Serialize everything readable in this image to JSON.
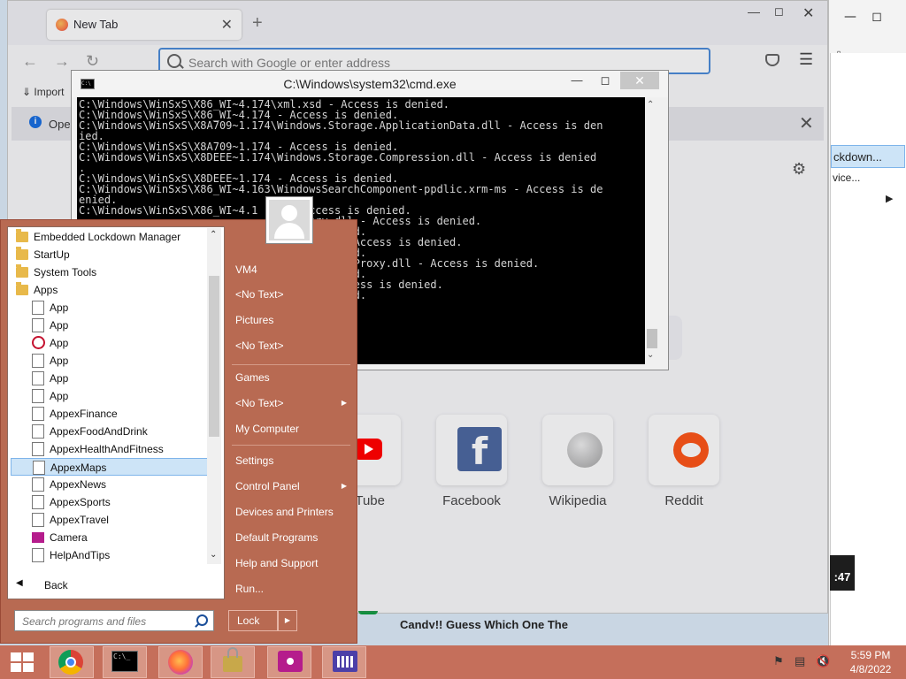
{
  "firefox": {
    "tab_title": "New Tab",
    "url_placeholder": "Search with Google or enter address",
    "import_bookmarks": "Import",
    "info_bar_text": "Open",
    "shortcuts": [
      {
        "label": "uTube"
      },
      {
        "label": "Facebook"
      },
      {
        "label": "Wikipedia"
      },
      {
        "label": "Reddit"
      }
    ],
    "news_headline": "Candy!! Guess Which One The",
    "video_duration": ":47"
  },
  "back_window": {
    "menu_text": "ckdown...",
    "submenu_text": "vice..."
  },
  "cmd": {
    "title": "C:\\Windows\\system32\\cmd.exe",
    "lines": [
      "C:\\Windows\\WinSxS\\X86_WI~4.174\\xml.xsd - Access is denied.",
      "C:\\Windows\\WinSxS\\X86_WI~4.174 - Access is denied.",
      "C:\\Windows\\WinSxS\\X8A709~1.174\\Windows.Storage.ApplicationData.dll - Access is den",
      "ied.",
      "C:\\Windows\\WinSxS\\X8A709~1.174 - Access is denied.",
      "C:\\Windows\\WinSxS\\X8DEEE~1.174\\Windows.Storage.Compression.dll - Access is denied",
      ".",
      "C:\\Windows\\WinSxS\\X8DEEE~1.174 - Access is denied.",
      "C:\\Windows\\WinSxS\\X86_WI~4.163\\WindowsSearchComponent-ppdlic.xrm-ms - Access is de",
      "enied.",
      "C:\\Windows\\WinSxS\\X86_WI~4.1       Access is denied.",
      "                                  Query.dll - Access is denied.",
      "                                   is denied.",
      "                            tionHost.exe - Access is denied.",
      "                                   is denied.",
      "                           PresentationHostProxy.dll - Access is denied.",
      "                                   is denied.",
      "                              dll.mui - Access is denied.",
      "                                   is denied.",
      "",
      "                    is denied.",
      "                       denied."
    ]
  },
  "start_menu": {
    "programs": [
      {
        "label": "Embedded Lockdown Manager",
        "icon": "folder"
      },
      {
        "label": "StartUp",
        "icon": "folder"
      },
      {
        "label": "System Tools",
        "icon": "folder"
      },
      {
        "label": "Apps",
        "icon": "folder-open"
      },
      {
        "label": "App",
        "icon": "doc"
      },
      {
        "label": "App",
        "icon": "doc"
      },
      {
        "label": "App",
        "icon": "alarm-clock"
      },
      {
        "label": "App",
        "icon": "doc"
      },
      {
        "label": "App",
        "icon": "doc"
      },
      {
        "label": "App",
        "icon": "doc"
      },
      {
        "label": "AppexFinance",
        "icon": "doc"
      },
      {
        "label": "AppexFoodAndDrink",
        "icon": "doc"
      },
      {
        "label": "AppexHealthAndFitness",
        "icon": "doc"
      },
      {
        "label": "AppexMaps",
        "icon": "doc"
      },
      {
        "label": "AppexNews",
        "icon": "doc"
      },
      {
        "label": "AppexSports",
        "icon": "doc"
      },
      {
        "label": "AppexTravel",
        "icon": "doc"
      },
      {
        "label": "Camera",
        "icon": "camera"
      },
      {
        "label": "HelpAndTips",
        "icon": "doc"
      }
    ],
    "back_label": "Back",
    "search_placeholder": "Search programs and files",
    "right_items": [
      {
        "label": "VM4"
      },
      {
        "label": "<No Text>"
      },
      {
        "label": "Pictures"
      },
      {
        "label": "<No Text>"
      },
      {
        "label": "Games"
      },
      {
        "label": "<No Text>"
      },
      {
        "label": "My Computer"
      },
      {
        "label": "Settings"
      },
      {
        "label": "Control Panel"
      },
      {
        "label": "Devices and Printers"
      },
      {
        "label": "Default Programs"
      },
      {
        "label": "Help and Support"
      },
      {
        "label": "Run..."
      }
    ],
    "lock_label": "Lock"
  },
  "taskbar": {
    "time": "5:59 PM",
    "date": "4/8/2022"
  }
}
